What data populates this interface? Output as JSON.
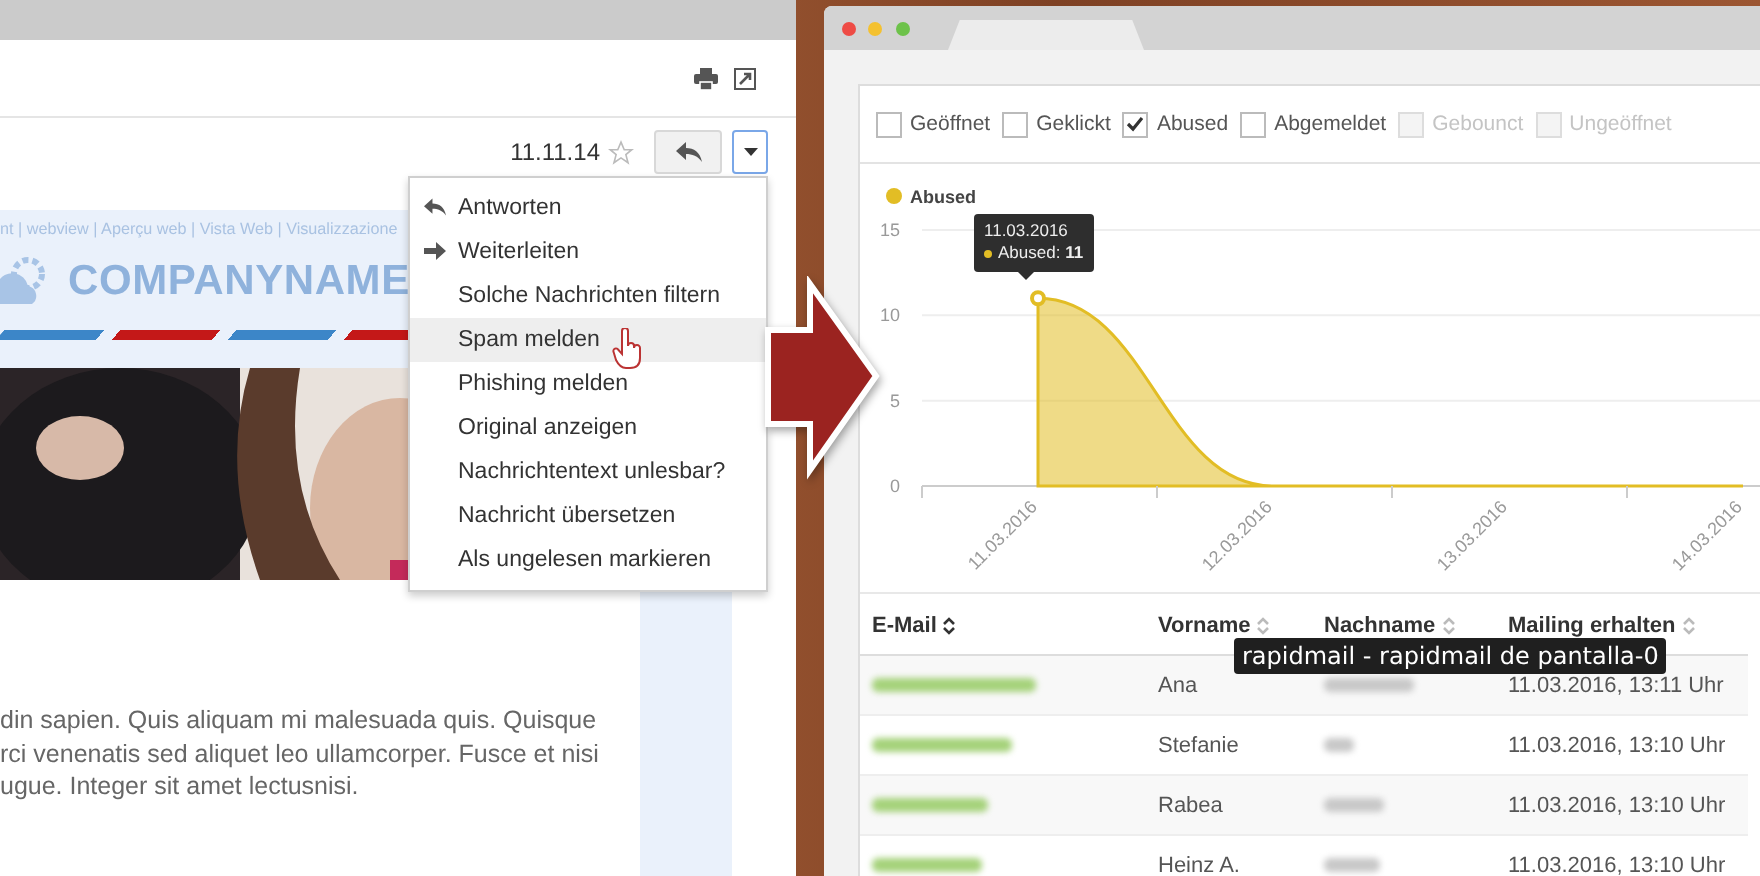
{
  "mail": {
    "date": "11.11.14",
    "reply_menu": {
      "expanded": true,
      "items": [
        {
          "label": "Antworten",
          "kind": "reply",
          "selected": false
        },
        {
          "label": "Weiterleiten",
          "kind": "forward",
          "selected": false
        },
        {
          "label": "Solche Nachrichten filtern",
          "kind": "plain",
          "selected": false
        },
        {
          "label": "Spam melden",
          "kind": "plain",
          "selected": true
        },
        {
          "label": "Phishing melden",
          "kind": "plain",
          "selected": false
        },
        {
          "label": "Original anzeigen",
          "kind": "plain",
          "selected": false
        },
        {
          "label": "Nachrichtentext unlesbar?",
          "kind": "plain",
          "selected": false
        },
        {
          "label": "Nachricht übersetzen",
          "kind": "plain",
          "selected": false
        },
        {
          "label": "Als ungelesen markieren",
          "kind": "plain",
          "selected": false
        }
      ]
    },
    "email": {
      "links": "nt | webview | Aperçu web | Vista Web | Visualizzazione",
      "logo": "COMPANYNAME",
      "body": "din sapien. Quis aliquam mi malesuada quis. Quisque\nrci venenatis sed aliquet leo ullamcorper. Fusce et nisi\nugue. Integer sit amet lectusnisi."
    }
  },
  "analytics": {
    "filters": [
      {
        "label": "Geöffnet",
        "checked": false,
        "disabled": false
      },
      {
        "label": "Geklickt",
        "checked": false,
        "disabled": false
      },
      {
        "label": "Abused",
        "checked": true,
        "disabled": false
      },
      {
        "label": "Abgemeldet",
        "checked": false,
        "disabled": false
      },
      {
        "label": "Gebounct",
        "checked": false,
        "disabled": true
      },
      {
        "label": "Ungeöffnet",
        "checked": false,
        "disabled": true
      }
    ],
    "chart": {
      "tooltip": {
        "date": "11.03.2016",
        "text": "Abused: **11**"
      },
      "chart_data": {
        "type": "area",
        "categories": [
          "11.03.2016",
          "12.03.2016",
          "13.03.2016",
          "14.03.2016"
        ],
        "series": [
          {
            "name": "Abused",
            "color": "#e2bd25",
            "values": [
              11,
              0,
              0,
              0
            ]
          }
        ],
        "ylim": [
          0,
          15
        ],
        "yticks": [
          0,
          5,
          10,
          15
        ]
      }
    },
    "table": {
      "columns": [
        {
          "label": "E-Mail",
          "sorted": true
        },
        {
          "label": "Vorname",
          "sorted": false
        },
        {
          "label": "Nachname",
          "sorted": false
        },
        {
          "label": "Mailing erhalten",
          "sorted": false
        }
      ],
      "rows": [
        {
          "first_name": "Ana",
          "received": "11.03.2016, 13:11 Uhr"
        },
        {
          "first_name": "Stefanie",
          "received": "11.03.2016, 13:10 Uhr"
        },
        {
          "first_name": "Rabea",
          "received": "11.03.2016, 13:10 Uhr"
        },
        {
          "first_name": "Heinz A.",
          "received": "11.03.2016, 13:10 Uhr"
        }
      ]
    }
  },
  "hover_tooltip": "rapidmail - rapidmail de pantalla-0"
}
